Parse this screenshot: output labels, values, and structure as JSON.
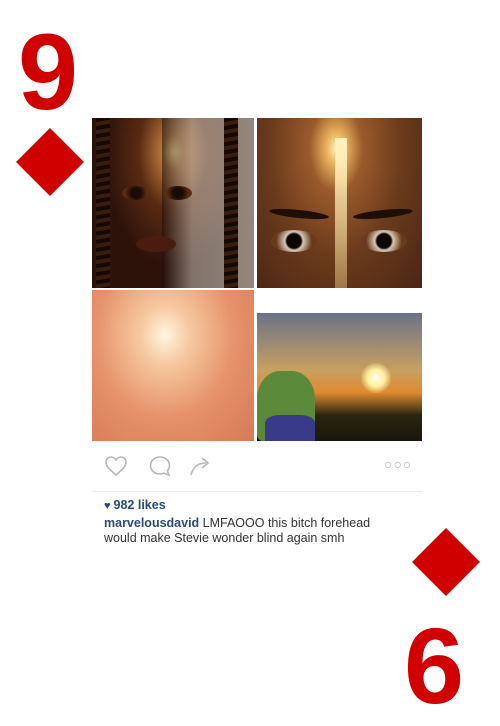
{
  "card": {
    "rank_top": "9",
    "rank_bottom": "6",
    "suit_icon": "diamond-icon",
    "suit_color": "#d00000"
  },
  "post": {
    "likes_icon": "heart-filled-icon",
    "likes": "982 likes",
    "username": "marvelousdavid",
    "caption": " LMFAOOO this bitch forehead would make Stevie wonder blind again smh",
    "icons": [
      "heart-outline-icon",
      "comment-icon",
      "share-icon",
      "more-options-icon"
    ],
    "more_glyph": "○○○"
  },
  "colors": {
    "link_blue": "#2a4a7a",
    "text": "#333333"
  }
}
